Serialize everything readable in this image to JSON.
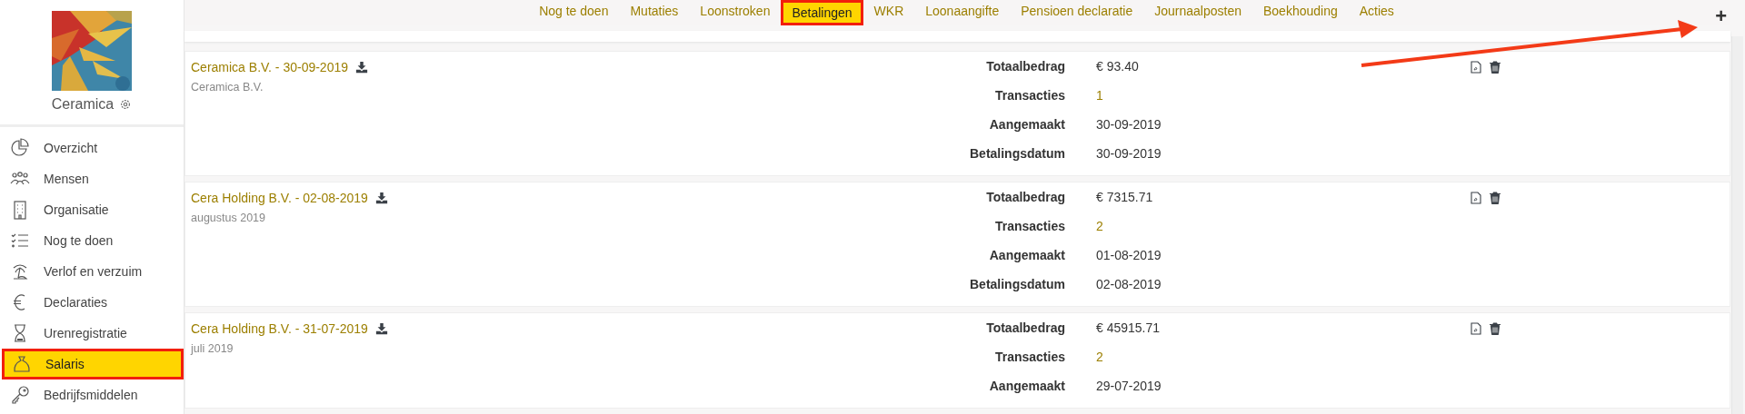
{
  "company": {
    "name": "Ceramica"
  },
  "sidebar": {
    "items": [
      {
        "label": "Overzicht",
        "selected": false
      },
      {
        "label": "Mensen",
        "selected": false
      },
      {
        "label": "Organisatie",
        "selected": false
      },
      {
        "label": "Nog te doen",
        "selected": false
      },
      {
        "label": "Verlof en verzuim",
        "selected": false
      },
      {
        "label": "Declaraties",
        "selected": false
      },
      {
        "label": "Urenregistratie",
        "selected": false
      },
      {
        "label": "Salaris",
        "selected": true
      },
      {
        "label": "Bedrijfsmiddelen",
        "selected": false
      }
    ]
  },
  "tabs": [
    {
      "label": "Nog te doen",
      "selected": false
    },
    {
      "label": "Mutaties",
      "selected": false
    },
    {
      "label": "Loonstroken",
      "selected": false
    },
    {
      "label": "Betalingen",
      "selected": true
    },
    {
      "label": "WKR",
      "selected": false
    },
    {
      "label": "Loonaangifte",
      "selected": false
    },
    {
      "label": "Pensioen declaratie",
      "selected": false
    },
    {
      "label": "Journaalposten",
      "selected": false
    },
    {
      "label": "Boekhouding",
      "selected": false
    },
    {
      "label": "Acties",
      "selected": false
    }
  ],
  "add_button": {
    "label": "+"
  },
  "payments": [
    {
      "title": "Ceramica B.V. - 30-09-2019",
      "subtitle": "Ceramica B.V.",
      "details": [
        {
          "label": "Totaalbedrag",
          "value": "€ 93.40",
          "kind": "text"
        },
        {
          "label": "Transacties",
          "value": "1",
          "kind": "link"
        },
        {
          "label": "Aangemaakt",
          "value": "30-09-2019",
          "kind": "text"
        },
        {
          "label": "Betalingsdatum",
          "value": "30-09-2019",
          "kind": "text"
        }
      ]
    },
    {
      "title": "Cera Holding B.V. - 02-08-2019",
      "subtitle": "augustus 2019",
      "details": [
        {
          "label": "Totaalbedrag",
          "value": "€ 7315.71",
          "kind": "text"
        },
        {
          "label": "Transacties",
          "value": "2",
          "kind": "link"
        },
        {
          "label": "Aangemaakt",
          "value": "01-08-2019",
          "kind": "text"
        },
        {
          "label": "Betalingsdatum",
          "value": "02-08-2019",
          "kind": "text"
        }
      ]
    },
    {
      "title": "Cera Holding B.V. - 31-07-2019",
      "subtitle": "juli 2019",
      "details": [
        {
          "label": "Totaalbedrag",
          "value": "€ 45915.71",
          "kind": "text"
        },
        {
          "label": "Transacties",
          "value": "2",
          "kind": "link"
        },
        {
          "label": "Aangemaakt",
          "value": "29-07-2019",
          "kind": "text"
        }
      ]
    }
  ]
}
